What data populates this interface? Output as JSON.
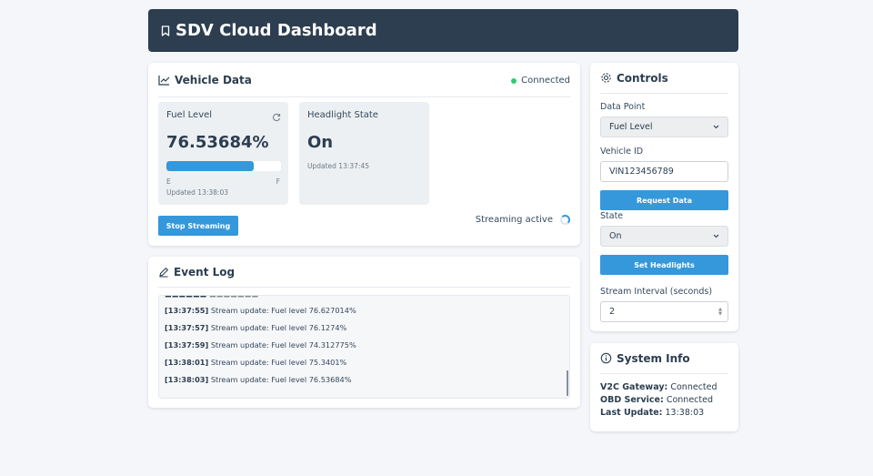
{
  "header": {
    "title": "SDV Cloud Dashboard"
  },
  "vehicle_data": {
    "title": "Vehicle Data",
    "connection_status": "Connected",
    "fuel": {
      "name": "Fuel Level",
      "value": "76.53684%",
      "level_percent": 76.53684,
      "empty_label": "E",
      "full_label": "F",
      "updated": "Updated 13:38:03"
    },
    "headlight": {
      "name": "Headlight State",
      "value": "On",
      "updated": "Updated 13:37:45"
    },
    "stop_streaming_label": "Stop Streaming",
    "streaming_status": "Streaming active"
  },
  "event_log": {
    "title": "Event Log",
    "entries": [
      {
        "time": "[13:37:55]",
        "message": "Stream update: Fuel level 76.627014%"
      },
      {
        "time": "[13:37:57]",
        "message": "Stream update: Fuel level 76.1274%"
      },
      {
        "time": "[13:37:59]",
        "message": "Stream update: Fuel level 74.312775%"
      },
      {
        "time": "[13:38:01]",
        "message": "Stream update: Fuel level 75.3401%"
      },
      {
        "time": "[13:38:03]",
        "message": "Stream update: Fuel level 76.53684%"
      }
    ]
  },
  "controls": {
    "title": "Controls",
    "data_point_label": "Data Point",
    "data_point_value": "Fuel Level",
    "vehicle_id_label": "Vehicle ID",
    "vehicle_id_value": "VIN123456789",
    "request_label": "Request Data",
    "state_label": "State",
    "state_value": "On",
    "set_headlights_label": "Set Headlights",
    "interval_label": "Stream Interval (seconds)",
    "interval_value": "2"
  },
  "system_info": {
    "title": "System Info",
    "items": [
      {
        "key": "V2C Gateway:",
        "value": "Connected"
      },
      {
        "key": "OBD Service:",
        "value": "Connected"
      },
      {
        "key": "Last Update:",
        "value": "13:38:03"
      }
    ]
  },
  "colors": {
    "accent": "#3498db",
    "header_bg": "#2c3e50",
    "connected": "#2ecc71"
  }
}
